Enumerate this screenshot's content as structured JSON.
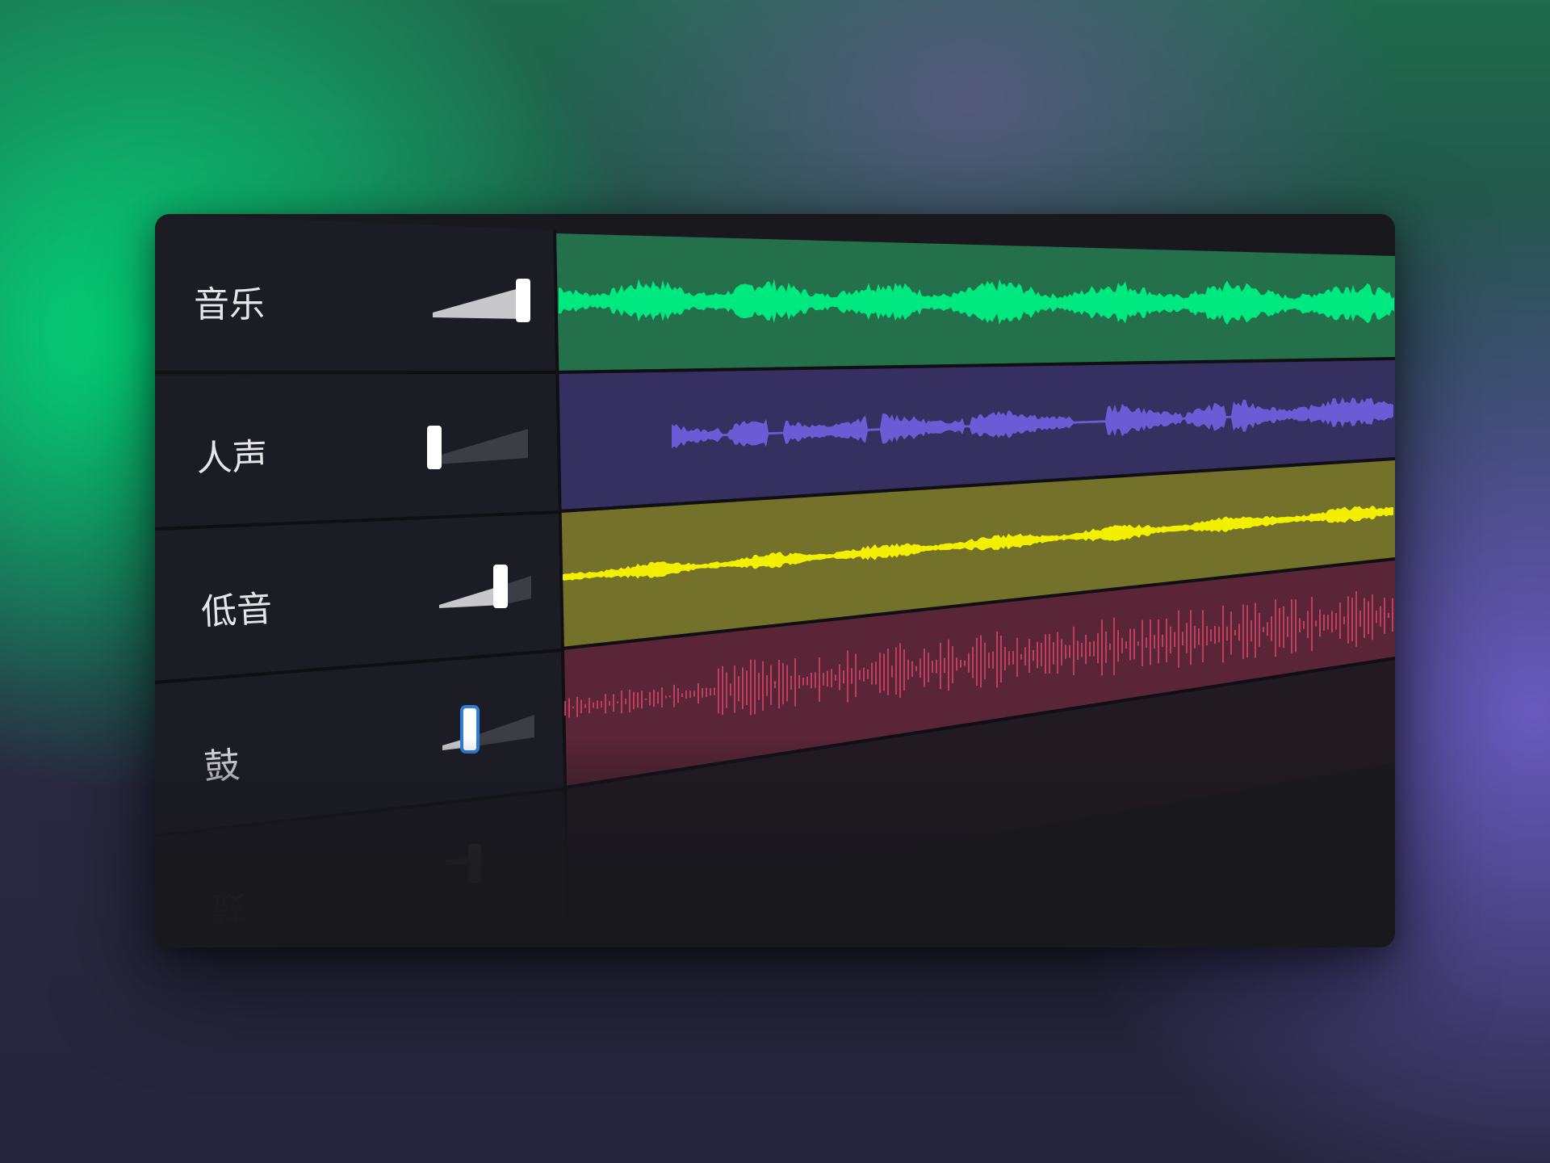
{
  "tracks": [
    {
      "label": "音乐",
      "volume": 1.0,
      "color": "#00e880",
      "lane_color": "#23704b"
    },
    {
      "label": "人声",
      "volume": 0.0,
      "color": "#6b5cd6",
      "lane_color": "#35305f"
    },
    {
      "label": "低音",
      "volume": 0.6,
      "color": "#f2ef00",
      "lane_color": "#74712a"
    },
    {
      "label": "鼓",
      "volume": 0.3,
      "color": "#d8466c",
      "lane_color": "#5a2536",
      "focused": true
    }
  ],
  "reflection_label": "鼓"
}
